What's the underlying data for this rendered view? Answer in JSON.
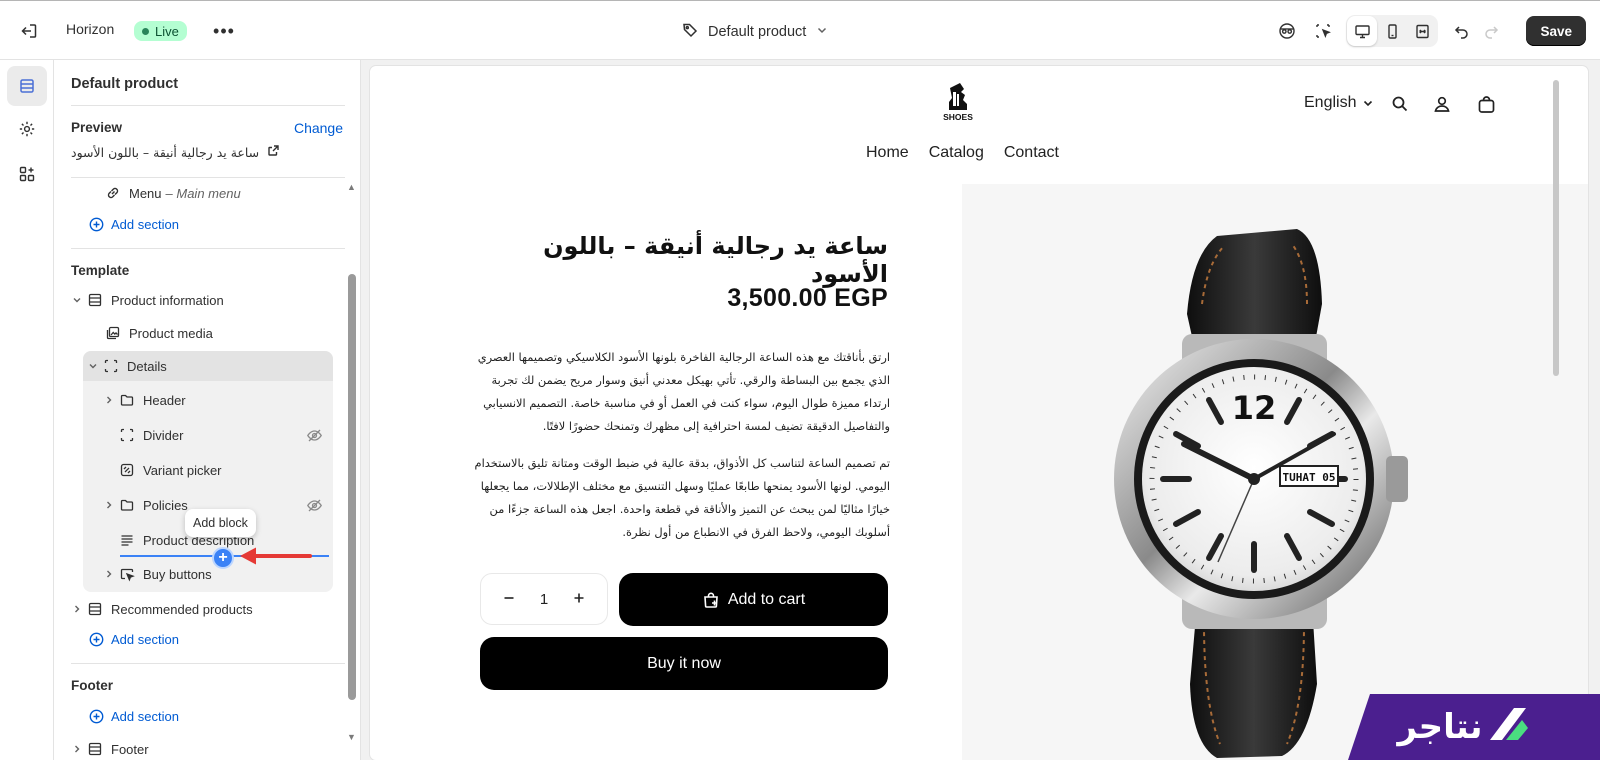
{
  "topbar": {
    "theme_name": "Horizon",
    "status": "Live",
    "page_selector": "Default product",
    "save_label": "Save"
  },
  "sidebar": {
    "title": "Default product",
    "preview_label": "Preview",
    "change_label": "Change",
    "preview_product": "ساعة يد رجالية أنيقة – باللون الأسود",
    "menu_label": "Menu",
    "menu_sub": "– Main menu",
    "add_section": "Add section",
    "template_label": "Template",
    "product_information": "Product information",
    "product_media": "Product media",
    "details": "Details",
    "blocks": {
      "header": "Header",
      "divider": "Divider",
      "variant_picker": "Variant picker",
      "policies": "Policies",
      "product_description": "Product description",
      "buy_buttons": "Buy buttons"
    },
    "recommended_products": "Recommended products",
    "footer_label": "Footer",
    "footer_item": "Footer",
    "tooltip": "Add block"
  },
  "preview": {
    "language": "English",
    "nav": [
      "Home",
      "Catalog",
      "Contact"
    ],
    "logo_text": "SHOES",
    "product_title": "ساعة يد رجالية أنيقة – باللون الأسود",
    "price": "3,500.00 EGP",
    "desc_lines_1": [
      "ارتق بأناقتك مع هذه الساعة الرجالية الفاخرة بلونها الأسود الكلاسيكي وتصميمها العصري",
      "الذي يجمع بين البساطة والرقي. تأتي بهيكل معدني أنيق وسوار مريح يضمن لك تجربة",
      "ارتداء مميزة طوال اليوم، سواء كنت في العمل أو في مناسبة خاصة. التصميم الانسيابي",
      "والتفاصيل الدقيقة تضيف لمسة احترافية إلى مظهرك وتمنحك حضورًا لافتًا."
    ],
    "desc_lines_2": [
      "تم تصميم الساعة لتناسب كل الأذواق، بدقة عالية في ضبط الوقت ومتانة تليق بالاستخدام",
      "اليومي. لونها الأسود يمنحها طابعًا عمليًا وسهل التنسيق مع مختلف الإطلالات، مما يجعلها",
      "خيارًا مثاليًا لمن يبحث عن التميز والأناقة في قطعة واحدة. اجعل هذه الساعة جزءًا من",
      "أسلوبك اليومي، ولاحظ الفرق في الانطباع من أول نظرة."
    ],
    "quantity": "1",
    "add_to_cart": "Add to cart",
    "buy_now": "Buy it now",
    "watch_dial_number": "12",
    "watch_date": "TUHAT 05"
  },
  "watermark": "نتاجر",
  "colors": {
    "accent_blue": "#005bd3",
    "live_badge": "#b4fed2",
    "insert_line": "#3b82f6",
    "arrow_red": "#e53935",
    "watermark_purple": "#4b1f8f"
  }
}
